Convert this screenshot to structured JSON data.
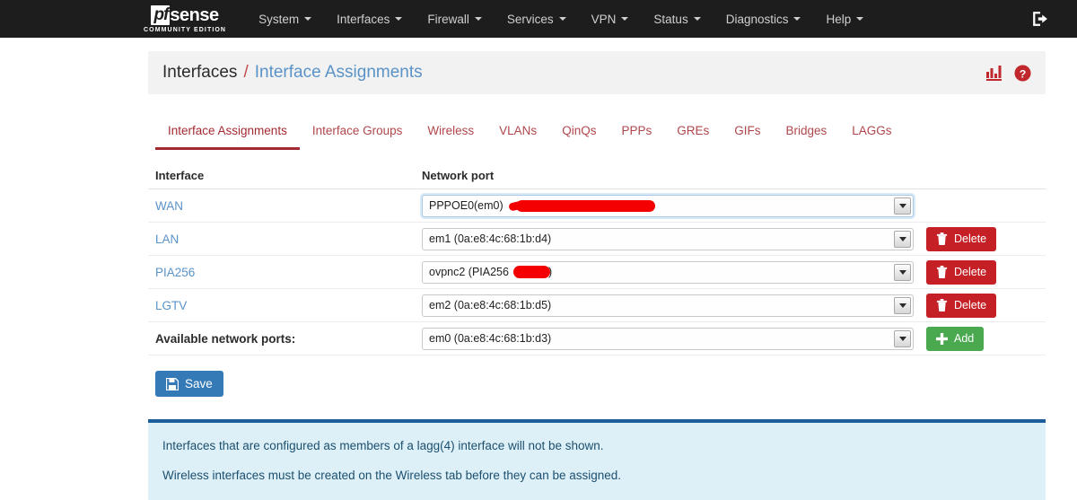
{
  "navbar": {
    "logo_main": "pf",
    "logo_rest": "sense",
    "logo_sub": "COMMUNITY EDITION",
    "items": [
      {
        "label": "System"
      },
      {
        "label": "Interfaces"
      },
      {
        "label": "Firewall"
      },
      {
        "label": "Services"
      },
      {
        "label": "VPN"
      },
      {
        "label": "Status"
      },
      {
        "label": "Diagnostics"
      },
      {
        "label": "Help"
      }
    ],
    "logout_icon": "logout-icon"
  },
  "breadcrumb": {
    "parent": "Interfaces",
    "separator": "/",
    "current": "Interface Assignments",
    "stats_icon": "bar-chart-icon",
    "help_icon": "help-circle-icon",
    "icon_color": "#c0282d"
  },
  "tabs": [
    {
      "label": "Interface Assignments",
      "active": true
    },
    {
      "label": "Interface Groups",
      "active": false
    },
    {
      "label": "Wireless",
      "active": false
    },
    {
      "label": "VLANs",
      "active": false
    },
    {
      "label": "QinQs",
      "active": false
    },
    {
      "label": "PPPs",
      "active": false
    },
    {
      "label": "GREs",
      "active": false
    },
    {
      "label": "GIFs",
      "active": false
    },
    {
      "label": "Bridges",
      "active": false
    },
    {
      "label": "LAGGs",
      "active": false
    }
  ],
  "table": {
    "headers": {
      "interface": "Interface",
      "network_port": "Network port"
    },
    "rows": [
      {
        "interface": "WAN",
        "port": "PPPOE0(em0)",
        "focused": true,
        "redacted": "wan",
        "delete_label": null
      },
      {
        "interface": "LAN",
        "port": "em1 (0a:e8:4c:68:1b:d4)",
        "focused": false,
        "redacted": null,
        "delete_label": "Delete"
      },
      {
        "interface": "PIA256",
        "port": "ovpnc2 (PIA256",
        "port_suffix": ")",
        "focused": false,
        "redacted": "pia",
        "delete_label": "Delete"
      },
      {
        "interface": "LGTV",
        "port": "em2 (0a:e8:4c:68:1b:d5)",
        "focused": false,
        "redacted": null,
        "delete_label": "Delete"
      }
    ],
    "available": {
      "label": "Available network ports:",
      "port": "em0 (0a:e8:4c:68:1b:d3)",
      "add_label": "Add"
    }
  },
  "save_button": {
    "label": "Save",
    "icon": "floppy-disk-icon",
    "color": "#337ab7"
  },
  "info_panel": {
    "line1": "Interfaces that are configured as members of a lagg(4) interface will not be shown.",
    "line2": "Wireless interfaces must be created on the Wireless tab before they can be assigned.",
    "accent_color": "#1c5d9b",
    "background_color": "#ddf0f8"
  }
}
